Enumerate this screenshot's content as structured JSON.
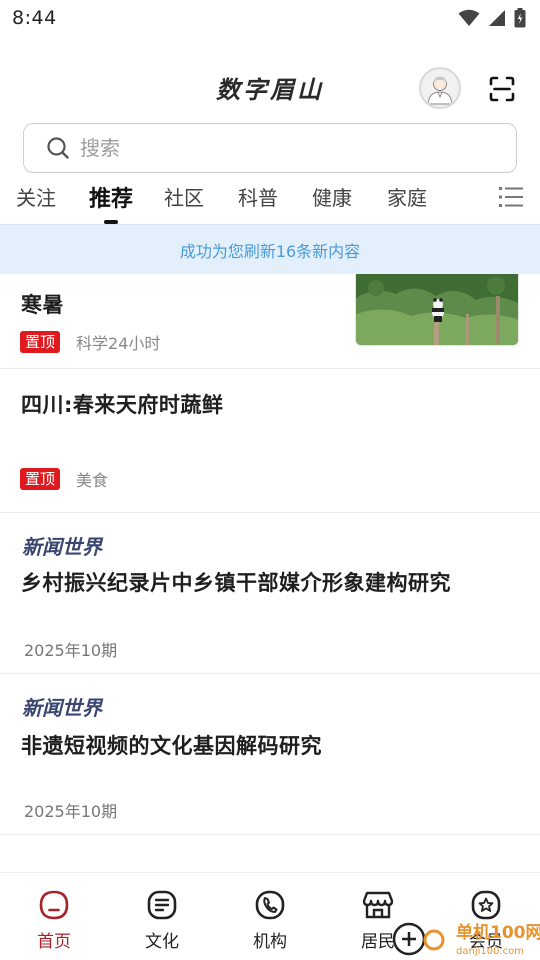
{
  "status_bar": {
    "time": "8:44"
  },
  "header": {
    "title": "数字眉山"
  },
  "search": {
    "placeholder": "搜索"
  },
  "tabs": [
    {
      "label": "关注"
    },
    {
      "label": "推荐",
      "active": true
    },
    {
      "label": "社区"
    },
    {
      "label": "科普"
    },
    {
      "label": "健康"
    },
    {
      "label": "家庭"
    }
  ],
  "refresh_banner": "成功为您刷新16条新内容",
  "feed": [
    {
      "title": "寒暑",
      "tag": "置顶",
      "category": "科学",
      "time": "24小时",
      "has_image": true,
      "image_icon": "panda-photo"
    },
    {
      "title": "四川:春来天府时蔬鲜",
      "tag": "置顶",
      "category": "美食"
    },
    {
      "source": "新闻世界",
      "title": "乡村振兴纪录片中乡镇干部媒介形象建构研究",
      "issue": "2025年10期"
    },
    {
      "source": "新闻世界",
      "title": "非遗短视频的文化基因解码研究",
      "issue": "2025年10期"
    }
  ],
  "bottom_nav": [
    {
      "label": "首页",
      "icon": "home-icon",
      "active": true
    },
    {
      "label": "文化",
      "icon": "culture-icon"
    },
    {
      "label": "机构",
      "icon": "phone-icon"
    },
    {
      "label": "居民",
      "icon": "shop-icon"
    },
    {
      "label": "会员",
      "icon": "star-icon"
    }
  ],
  "watermark": {
    "text": "单机100网",
    "url_text": "danji100.com"
  },
  "colors": {
    "accent": "#a8222a",
    "pin": "#e0191f",
    "banner_bg": "#e3f0fb",
    "banner_text": "#4a9ad8",
    "source_logo": "#3a4670"
  }
}
